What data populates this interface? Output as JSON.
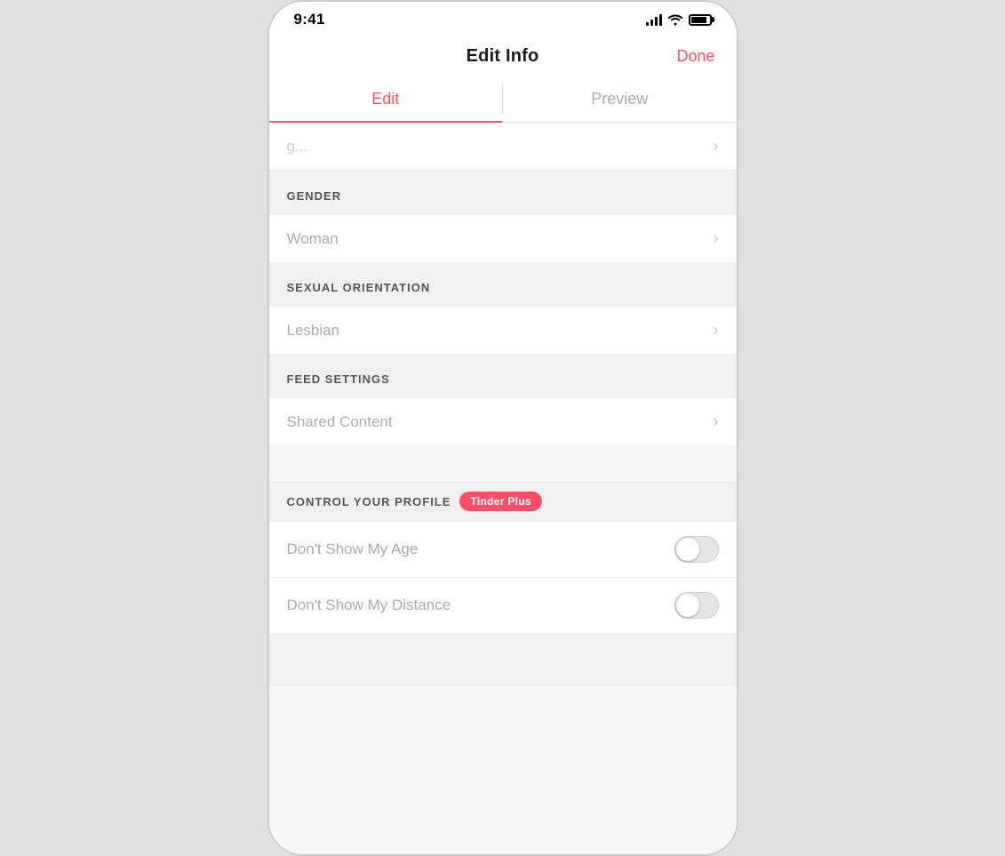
{
  "statusBar": {
    "time": "9:41",
    "batteryLevel": "85%"
  },
  "header": {
    "title": "Edit Info",
    "doneLabel": "Done"
  },
  "tabs": [
    {
      "id": "edit",
      "label": "Edit",
      "active": true
    },
    {
      "id": "preview",
      "label": "Preview",
      "active": false
    }
  ],
  "sections": [
    {
      "id": "gender",
      "title": "GENDER",
      "rows": [
        {
          "id": "gender-value",
          "label": "Woman",
          "hasChevron": true
        }
      ]
    },
    {
      "id": "sexual-orientation",
      "title": "SEXUAL ORIENTATION",
      "rows": [
        {
          "id": "orientation-value",
          "label": "Lesbian",
          "hasChevron": true
        }
      ]
    },
    {
      "id": "feed-settings",
      "title": "FEED SETTINGS",
      "rows": [
        {
          "id": "shared-content",
          "label": "Shared Content",
          "hasChevron": true
        }
      ]
    },
    {
      "id": "control-profile",
      "title": "CONTROL YOUR PROFILE",
      "badge": "Tinder Plus",
      "rows": [
        {
          "id": "dont-show-age",
          "label": "Don't Show My Age",
          "hasToggle": true,
          "toggleOn": false
        },
        {
          "id": "dont-show-distance",
          "label": "Don't Show My Distance",
          "hasToggle": true,
          "toggleOn": false
        }
      ]
    }
  ],
  "partialRow": {
    "placeholder": "g..."
  },
  "icons": {
    "chevron": "›",
    "signal": "▐",
    "wifi": "wifi",
    "battery": "battery"
  },
  "colors": {
    "accent": "#fd5068",
    "inactive": "#aaa",
    "sectionBg": "#f0f0f0",
    "border": "#e5e5e5"
  }
}
